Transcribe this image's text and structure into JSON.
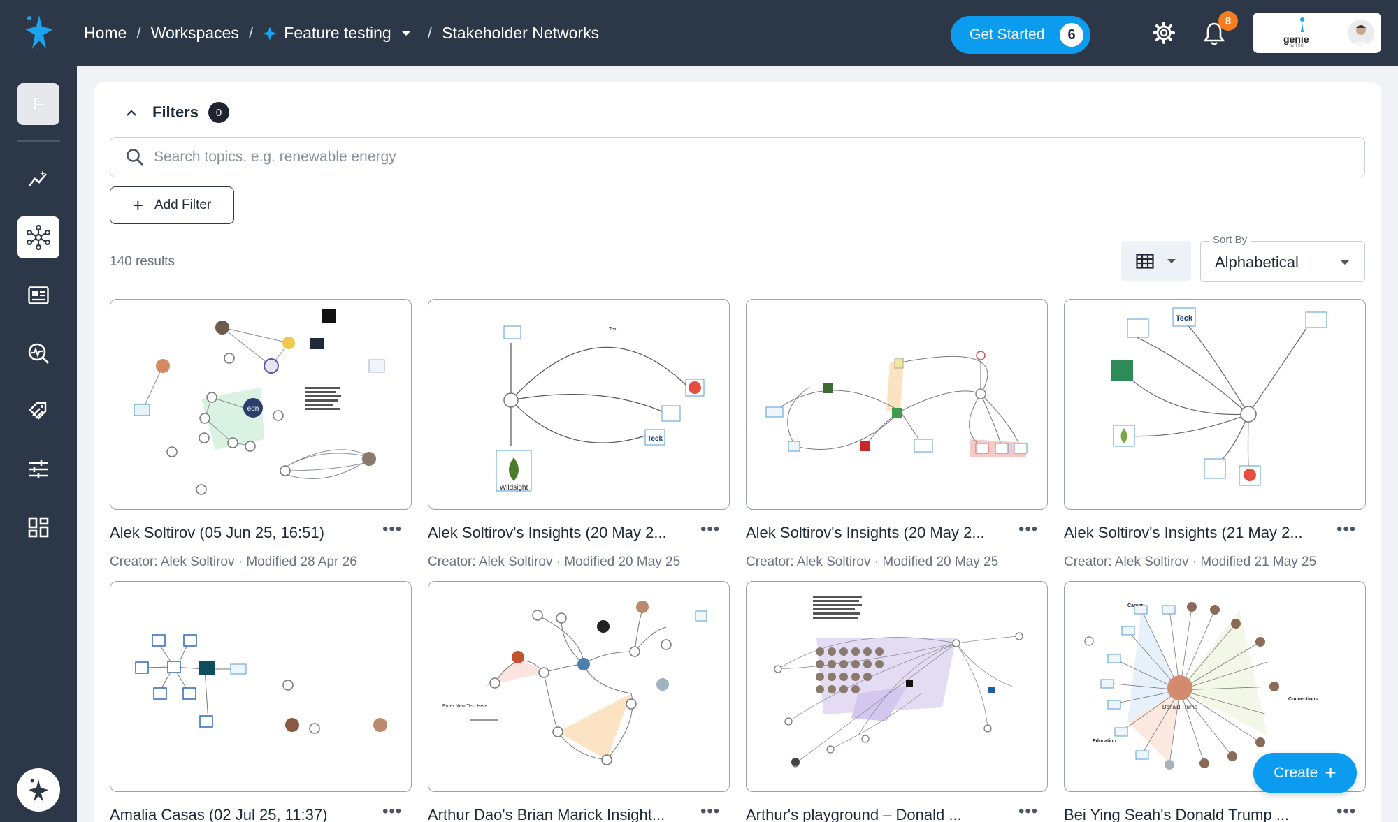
{
  "breadcrumb": {
    "home": "Home",
    "workspaces": "Workspaces",
    "workspace": "Feature testing",
    "current": "Stakeholder Networks"
  },
  "header": {
    "get_started_label": "Get Started",
    "get_started_count": "6",
    "notification_count": "8",
    "brand_text": "genie",
    "brand_sub": "by TSC"
  },
  "sidebar": {
    "workspace_initial": "F",
    "items": [
      "insights-icon",
      "network-icon",
      "news-icon",
      "monitor-icon",
      "tags-icon",
      "sliders-icon",
      "dashboard-icon"
    ]
  },
  "filters": {
    "title": "Filters",
    "count": "0",
    "search_placeholder": "Search topics, e.g. renewable energy",
    "add_filter_label": "Add Filter"
  },
  "results": {
    "count_text": "140 results",
    "sort_label": "Sort By",
    "sort_value": "Alphabetical"
  },
  "cards": [
    {
      "title": "Alek Soltirov (05 Jun 25, 16:51)",
      "meta": "Creator: Alek Soltirov · Modified 28 Apr 26"
    },
    {
      "title": "Alek Soltirov's Insights (20 May 2...",
      "meta": "Creator: Alek Soltirov · Modified 20 May 25"
    },
    {
      "title": "Alek Soltirov's Insights (20 May 2...",
      "meta": "Creator: Alek Soltirov · Modified 20 May 25"
    },
    {
      "title": "Alek Soltirov's Insights (21 May 2...",
      "meta": "Creator: Alek Soltirov · Modified 21 May 25"
    },
    {
      "title": "Amalia Casas (02 Jul 25, 11:37)",
      "meta": ""
    },
    {
      "title": "Arthur Dao's Brian Marick Insight...",
      "meta": ""
    },
    {
      "title": "Arthur's playground – Donald ...",
      "meta": ""
    },
    {
      "title": "Bei Ying Seah's Donald Trump ...",
      "meta": ""
    }
  ],
  "thumb_text": {
    "t2_text": "Text",
    "t2_wildsight": "Wildsight",
    "t2_teck": "Teck",
    "t4_teck": "Teck",
    "t8_name": "Donald Trump",
    "t8_career": "Career",
    "t8_connections": "Connections",
    "t8_education": "Education",
    "t1_edn": "edn",
    "t6_enter": "Enter New Text Here"
  },
  "create_label": "Create",
  "colors": {
    "topbar": "#2c3747",
    "accent": "#0b9cf0",
    "badge": "#f57c1f"
  }
}
